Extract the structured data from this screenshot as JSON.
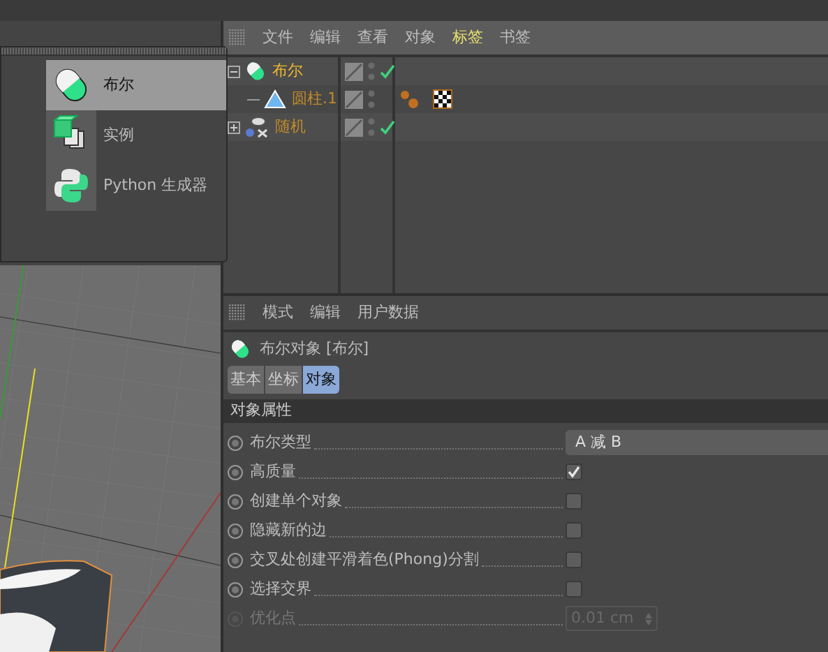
{
  "popup_menu": {
    "items": [
      {
        "label": "布尔",
        "kind": "boole",
        "selected": true
      },
      {
        "label": "实例",
        "kind": "instance",
        "selected": false
      },
      {
        "label": "Python 生成器",
        "kind": "python",
        "selected": false
      }
    ]
  },
  "object_manager": {
    "menu": [
      {
        "label": "文件",
        "selected": false
      },
      {
        "label": "编辑",
        "selected": false
      },
      {
        "label": "查看",
        "selected": false
      },
      {
        "label": "对象",
        "selected": false
      },
      {
        "label": "标签",
        "selected": true
      },
      {
        "label": "书签",
        "selected": false
      }
    ],
    "objects": [
      {
        "name": "布尔",
        "kind": "boole",
        "selected": true,
        "expanded": true,
        "enabled": true,
        "children": [
          {
            "name": "圆柱.1",
            "kind": "cylinder",
            "selected": false,
            "enabled": false,
            "tags": [
              {
                "kind": "phong"
              },
              {
                "kind": "texture"
              }
            ]
          }
        ]
      },
      {
        "name": "随机",
        "kind": "random",
        "selected": false,
        "expanded": false,
        "enabled": true
      }
    ]
  },
  "attribute_manager": {
    "menu": [
      "模式",
      "编辑",
      "用户数据"
    ],
    "title": "布尔对象 [布尔]",
    "tabs": [
      {
        "label": "基本",
        "selected": false
      },
      {
        "label": "坐标",
        "selected": false
      },
      {
        "label": "对象",
        "selected": true
      }
    ],
    "section": "对象属性",
    "properties": [
      {
        "kind": "dropdown",
        "label": "布尔类型",
        "value": "A 减 B",
        "disabled": false
      },
      {
        "kind": "checkbox",
        "label": "高质量",
        "checked": true,
        "disabled": false
      },
      {
        "kind": "checkbox",
        "label": "创建单个对象",
        "checked": false,
        "disabled": false
      },
      {
        "kind": "checkbox",
        "label": "隐藏新的边",
        "checked": false,
        "disabled": false
      },
      {
        "kind": "checkbox",
        "label": "交叉处创建平滑着色(Phong)分割",
        "checked": false,
        "disabled": false
      },
      {
        "kind": "checkbox",
        "label": "选择交界",
        "checked": false,
        "disabled": false
      },
      {
        "kind": "number",
        "label": "优化点",
        "value": "0.01 cm",
        "disabled": true
      }
    ]
  }
}
